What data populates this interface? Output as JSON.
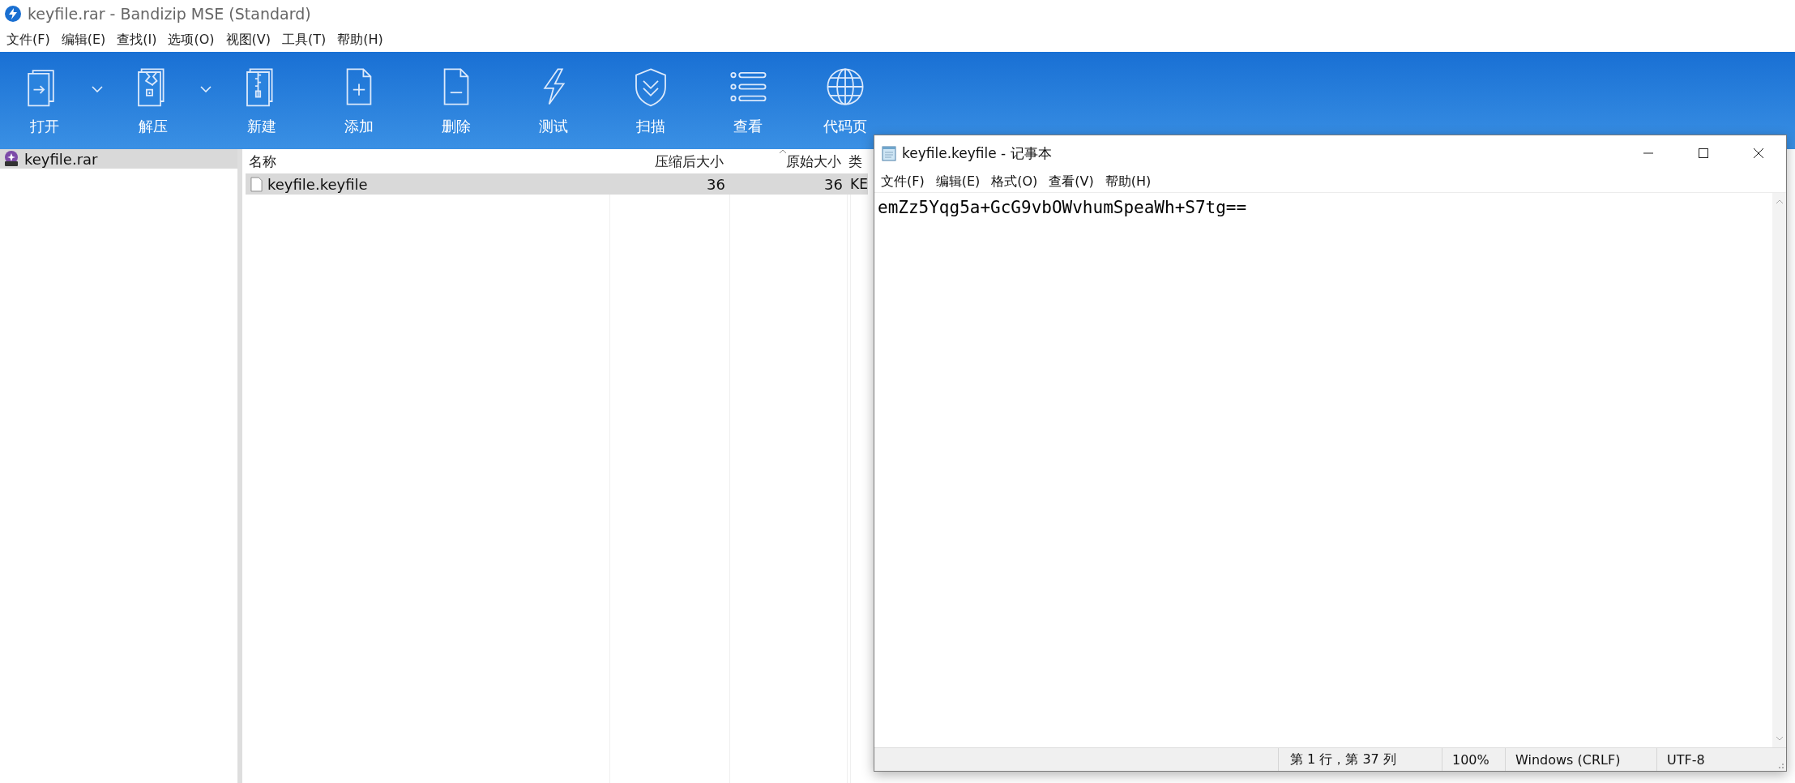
{
  "main_window": {
    "title": "keyfile.rar - Bandizip MSE (Standard)",
    "menu": [
      "文件(F)",
      "编辑(E)",
      "查找(I)",
      "选项(O)",
      "视图(V)",
      "工具(T)",
      "帮助(H)"
    ],
    "toolbar": [
      {
        "label": "打开",
        "kind": "open",
        "dropdown": true
      },
      {
        "label": "解压",
        "kind": "extract",
        "dropdown": true
      },
      {
        "label": "新建",
        "kind": "new",
        "dropdown": false
      },
      {
        "label": "添加",
        "kind": "add",
        "dropdown": false
      },
      {
        "label": "删除",
        "kind": "delete",
        "dropdown": false
      },
      {
        "label": "测试",
        "kind": "test",
        "dropdown": false
      },
      {
        "label": "扫描",
        "kind": "scan",
        "dropdown": false
      },
      {
        "label": "查看",
        "kind": "view",
        "dropdown": false
      },
      {
        "label": "代码页",
        "kind": "codepage",
        "dropdown": false
      }
    ]
  },
  "tree": [
    {
      "label": "keyfile.rar",
      "selected": true
    }
  ],
  "file_list": {
    "columns": [
      "名称",
      "压缩后大小",
      "原始大小",
      "类"
    ],
    "rows": [
      {
        "name": "keyfile.keyfile",
        "packed": "36",
        "size": "36",
        "type": "KE",
        "selected": true
      }
    ]
  },
  "notepad": {
    "title": "keyfile.keyfile - 记事本",
    "menu": [
      "文件(F)",
      "编辑(E)",
      "格式(O)",
      "查看(V)",
      "帮助(H)"
    ],
    "text": "emZz5Yqg5a+GcG9vbOWvhumSpeaWh+S7tg==",
    "status": [
      "第 1 行，第 37 列",
      "100%",
      "Windows (CRLF)",
      "UTF-8"
    ]
  }
}
